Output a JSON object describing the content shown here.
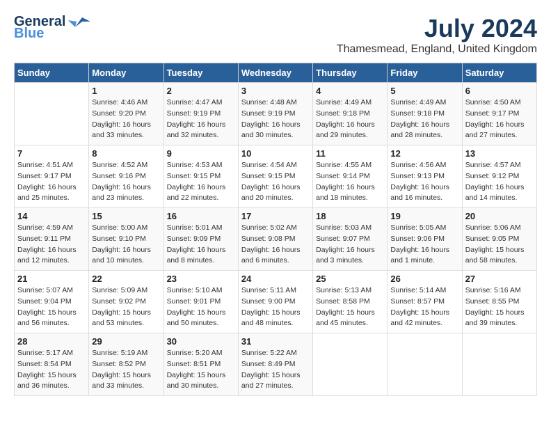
{
  "header": {
    "logo_general": "General",
    "logo_blue": "Blue",
    "month_year": "July 2024",
    "location": "Thamesmead, England, United Kingdom"
  },
  "calendar": {
    "days_of_week": [
      "Sunday",
      "Monday",
      "Tuesday",
      "Wednesday",
      "Thursday",
      "Friday",
      "Saturday"
    ],
    "weeks": [
      [
        {
          "day": "",
          "sunrise": "",
          "sunset": "",
          "daylight": ""
        },
        {
          "day": "1",
          "sunrise": "Sunrise: 4:46 AM",
          "sunset": "Sunset: 9:20 PM",
          "daylight": "Daylight: 16 hours and 33 minutes."
        },
        {
          "day": "2",
          "sunrise": "Sunrise: 4:47 AM",
          "sunset": "Sunset: 9:19 PM",
          "daylight": "Daylight: 16 hours and 32 minutes."
        },
        {
          "day": "3",
          "sunrise": "Sunrise: 4:48 AM",
          "sunset": "Sunset: 9:19 PM",
          "daylight": "Daylight: 16 hours and 30 minutes."
        },
        {
          "day": "4",
          "sunrise": "Sunrise: 4:49 AM",
          "sunset": "Sunset: 9:18 PM",
          "daylight": "Daylight: 16 hours and 29 minutes."
        },
        {
          "day": "5",
          "sunrise": "Sunrise: 4:49 AM",
          "sunset": "Sunset: 9:18 PM",
          "daylight": "Daylight: 16 hours and 28 minutes."
        },
        {
          "day": "6",
          "sunrise": "Sunrise: 4:50 AM",
          "sunset": "Sunset: 9:17 PM",
          "daylight": "Daylight: 16 hours and 27 minutes."
        }
      ],
      [
        {
          "day": "7",
          "sunrise": "Sunrise: 4:51 AM",
          "sunset": "Sunset: 9:17 PM",
          "daylight": "Daylight: 16 hours and 25 minutes."
        },
        {
          "day": "8",
          "sunrise": "Sunrise: 4:52 AM",
          "sunset": "Sunset: 9:16 PM",
          "daylight": "Daylight: 16 hours and 23 minutes."
        },
        {
          "day": "9",
          "sunrise": "Sunrise: 4:53 AM",
          "sunset": "Sunset: 9:15 PM",
          "daylight": "Daylight: 16 hours and 22 minutes."
        },
        {
          "day": "10",
          "sunrise": "Sunrise: 4:54 AM",
          "sunset": "Sunset: 9:15 PM",
          "daylight": "Daylight: 16 hours and 20 minutes."
        },
        {
          "day": "11",
          "sunrise": "Sunrise: 4:55 AM",
          "sunset": "Sunset: 9:14 PM",
          "daylight": "Daylight: 16 hours and 18 minutes."
        },
        {
          "day": "12",
          "sunrise": "Sunrise: 4:56 AM",
          "sunset": "Sunset: 9:13 PM",
          "daylight": "Daylight: 16 hours and 16 minutes."
        },
        {
          "day": "13",
          "sunrise": "Sunrise: 4:57 AM",
          "sunset": "Sunset: 9:12 PM",
          "daylight": "Daylight: 16 hours and 14 minutes."
        }
      ],
      [
        {
          "day": "14",
          "sunrise": "Sunrise: 4:59 AM",
          "sunset": "Sunset: 9:11 PM",
          "daylight": "Daylight: 16 hours and 12 minutes."
        },
        {
          "day": "15",
          "sunrise": "Sunrise: 5:00 AM",
          "sunset": "Sunset: 9:10 PM",
          "daylight": "Daylight: 16 hours and 10 minutes."
        },
        {
          "day": "16",
          "sunrise": "Sunrise: 5:01 AM",
          "sunset": "Sunset: 9:09 PM",
          "daylight": "Daylight: 16 hours and 8 minutes."
        },
        {
          "day": "17",
          "sunrise": "Sunrise: 5:02 AM",
          "sunset": "Sunset: 9:08 PM",
          "daylight": "Daylight: 16 hours and 6 minutes."
        },
        {
          "day": "18",
          "sunrise": "Sunrise: 5:03 AM",
          "sunset": "Sunset: 9:07 PM",
          "daylight": "Daylight: 16 hours and 3 minutes."
        },
        {
          "day": "19",
          "sunrise": "Sunrise: 5:05 AM",
          "sunset": "Sunset: 9:06 PM",
          "daylight": "Daylight: 16 hours and 1 minute."
        },
        {
          "day": "20",
          "sunrise": "Sunrise: 5:06 AM",
          "sunset": "Sunset: 9:05 PM",
          "daylight": "Daylight: 15 hours and 58 minutes."
        }
      ],
      [
        {
          "day": "21",
          "sunrise": "Sunrise: 5:07 AM",
          "sunset": "Sunset: 9:04 PM",
          "daylight": "Daylight: 15 hours and 56 minutes."
        },
        {
          "day": "22",
          "sunrise": "Sunrise: 5:09 AM",
          "sunset": "Sunset: 9:02 PM",
          "daylight": "Daylight: 15 hours and 53 minutes."
        },
        {
          "day": "23",
          "sunrise": "Sunrise: 5:10 AM",
          "sunset": "Sunset: 9:01 PM",
          "daylight": "Daylight: 15 hours and 50 minutes."
        },
        {
          "day": "24",
          "sunrise": "Sunrise: 5:11 AM",
          "sunset": "Sunset: 9:00 PM",
          "daylight": "Daylight: 15 hours and 48 minutes."
        },
        {
          "day": "25",
          "sunrise": "Sunrise: 5:13 AM",
          "sunset": "Sunset: 8:58 PM",
          "daylight": "Daylight: 15 hours and 45 minutes."
        },
        {
          "day": "26",
          "sunrise": "Sunrise: 5:14 AM",
          "sunset": "Sunset: 8:57 PM",
          "daylight": "Daylight: 15 hours and 42 minutes."
        },
        {
          "day": "27",
          "sunrise": "Sunrise: 5:16 AM",
          "sunset": "Sunset: 8:55 PM",
          "daylight": "Daylight: 15 hours and 39 minutes."
        }
      ],
      [
        {
          "day": "28",
          "sunrise": "Sunrise: 5:17 AM",
          "sunset": "Sunset: 8:54 PM",
          "daylight": "Daylight: 15 hours and 36 minutes."
        },
        {
          "day": "29",
          "sunrise": "Sunrise: 5:19 AM",
          "sunset": "Sunset: 8:52 PM",
          "daylight": "Daylight: 15 hours and 33 minutes."
        },
        {
          "day": "30",
          "sunrise": "Sunrise: 5:20 AM",
          "sunset": "Sunset: 8:51 PM",
          "daylight": "Daylight: 15 hours and 30 minutes."
        },
        {
          "day": "31",
          "sunrise": "Sunrise: 5:22 AM",
          "sunset": "Sunset: 8:49 PM",
          "daylight": "Daylight: 15 hours and 27 minutes."
        },
        {
          "day": "",
          "sunrise": "",
          "sunset": "",
          "daylight": ""
        },
        {
          "day": "",
          "sunrise": "",
          "sunset": "",
          "daylight": ""
        },
        {
          "day": "",
          "sunrise": "",
          "sunset": "",
          "daylight": ""
        }
      ]
    ]
  }
}
